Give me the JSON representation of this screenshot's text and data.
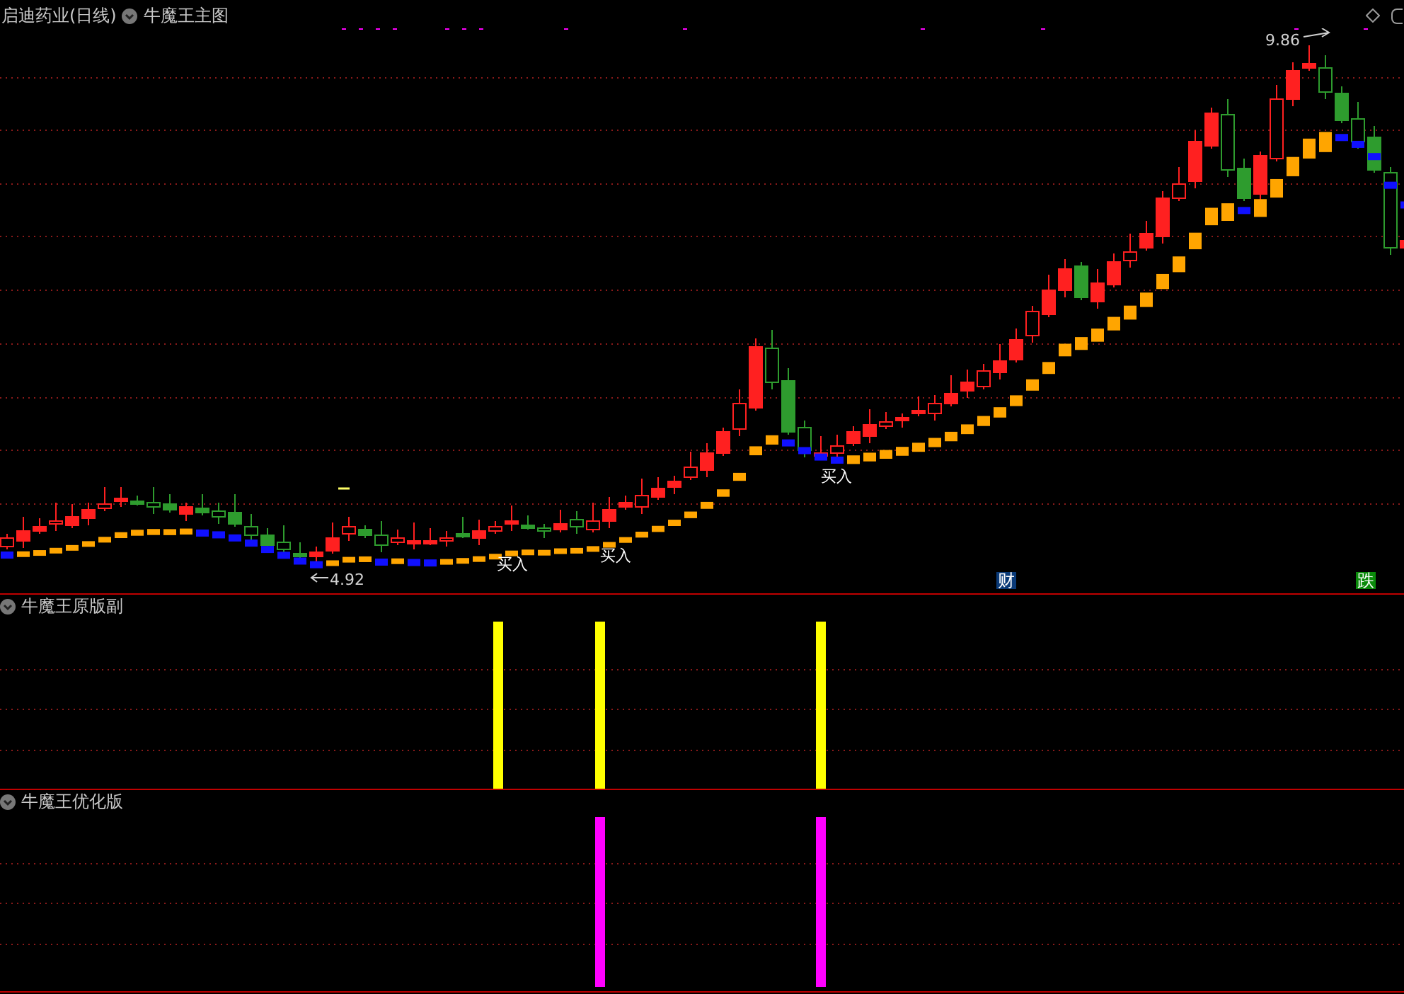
{
  "header": {
    "stock": "启迪药业(日线)",
    "indicator": "牛魔王主图"
  },
  "main_chart": {
    "high_label": "9.86",
    "low_label": "4.92",
    "signals": [
      "买入",
      "买入",
      "买入"
    ],
    "badges": [
      {
        "text": "财",
        "kind": "finance"
      },
      {
        "text": "跌",
        "kind": "fall"
      }
    ]
  },
  "panels": [
    {
      "title": "牛魔王原版副",
      "kind": "yellow-bars"
    },
    {
      "title": "牛魔王优化版",
      "kind": "magenta-bars"
    }
  ]
}
